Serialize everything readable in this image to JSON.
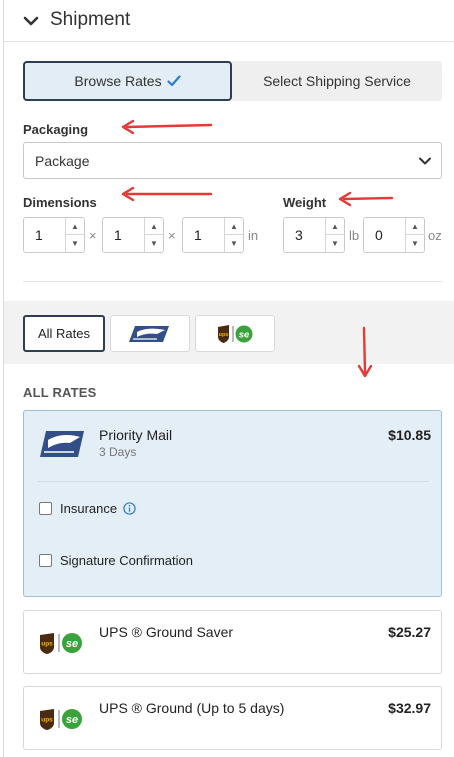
{
  "header": {
    "title": "Shipment",
    "collapse_icon": "chevron-down-icon"
  },
  "mode_toggle": {
    "browse_rates": "Browse Rates",
    "select_service": "Select Shipping Service"
  },
  "packaging": {
    "label": "Packaging",
    "value": "Package"
  },
  "dimensions": {
    "label": "Dimensions",
    "length": "1",
    "width": "1",
    "height": "1",
    "times": "×",
    "unit": "in"
  },
  "weight": {
    "label": "Weight",
    "lb": "3",
    "lb_unit": "lb",
    "oz": "0",
    "oz_unit": "oz"
  },
  "carrier_tabs": {
    "all_rates": "All Rates",
    "usps_icon": "usps-eagle-icon",
    "ups_se_icon": "ups-se-icon"
  },
  "rates": {
    "section_title": "ALL RATES",
    "items": [
      {
        "name": "Priority Mail",
        "eta": "3 Days",
        "price": "$10.85",
        "carrier": "USPS",
        "options": {
          "insurance": "Insurance",
          "signature": "Signature Confirmation"
        }
      },
      {
        "name": "UPS ® Ground Saver",
        "price": "$25.27",
        "carrier": "UPS"
      },
      {
        "name": "UPS ® Ground (Up to 5 days)",
        "price": "$32.97",
        "carrier": "UPS"
      }
    ]
  },
  "colors": {
    "accent_border": "#2e3e52",
    "selected_bg": "#e3eef6",
    "annotation_red": "#e53935",
    "usps_blue": "#334f87",
    "ups_brown": "#4b2a12",
    "se_green": "#3aa23a"
  }
}
